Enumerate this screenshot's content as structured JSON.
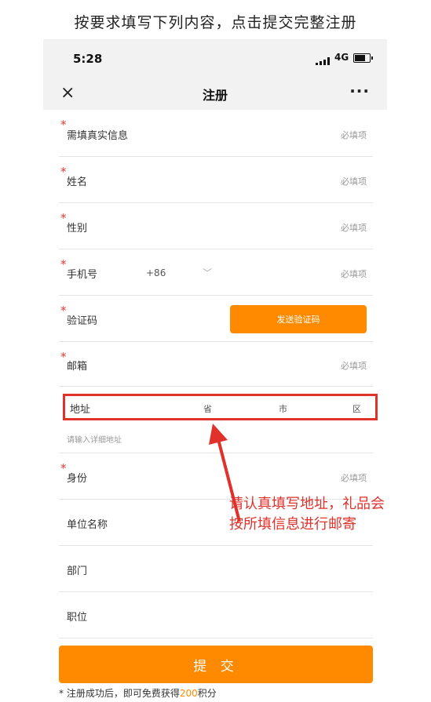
{
  "instruction": "按要求填写下列内容，点击提交完整注册",
  "status": {
    "time": "5:28",
    "network": "4G"
  },
  "navbar": {
    "close_icon": "×",
    "title": "注册",
    "more_icon": "···"
  },
  "form": {
    "rows": [
      {
        "label": "需填真实信息",
        "required": true,
        "placeholder": "必填项"
      },
      {
        "label": "姓名",
        "required": true,
        "placeholder": "必填项"
      },
      {
        "label": "性别",
        "required": true,
        "placeholder": "必填项"
      },
      {
        "label": "手机号",
        "required": true,
        "prefix": "+86",
        "placeholder": "必填项"
      },
      {
        "label": "验证码",
        "required": true,
        "button": "发送验证码"
      },
      {
        "label": "邮箱",
        "required": true,
        "placeholder": "必填项"
      },
      {
        "label": "身份",
        "required": true,
        "placeholder": "必填项"
      },
      {
        "label": "单位名称",
        "required": false
      },
      {
        "label": "部门",
        "required": false
      },
      {
        "label": "职位",
        "required": false
      }
    ],
    "required_mark": "*",
    "address": {
      "label": "地址",
      "province": "省",
      "city": "市",
      "district": "区",
      "detail_placeholder": "请输入详细地址"
    }
  },
  "submit_label": "提 交",
  "note": {
    "prefix": "* 注册成功后，即可免费获得",
    "points": "200",
    "suffix": "积分"
  },
  "annotation": "请认真填写地址，礼品会按所填信息进行邮寄",
  "colors": {
    "accent": "#ff8a00",
    "annotation": "#e0312b",
    "required": "#e53935"
  }
}
